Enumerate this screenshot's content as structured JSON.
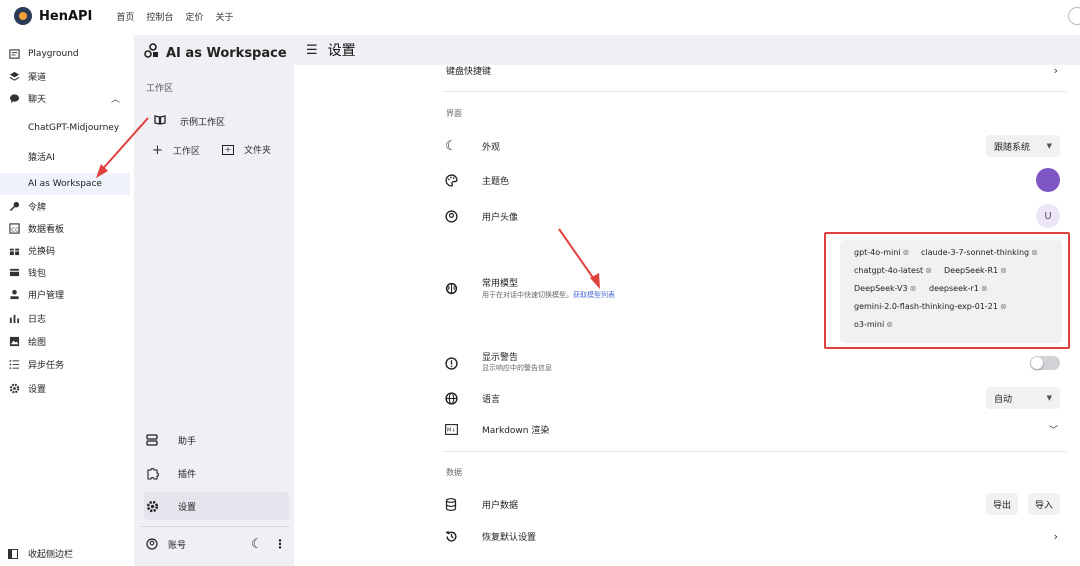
{
  "brand": {
    "name": "HenAPI"
  },
  "topnav": [
    "首页",
    "控制台",
    "定价",
    "关于"
  ],
  "sidebar": {
    "items": [
      {
        "label": "Playground",
        "icon": "chat-square-icon"
      },
      {
        "label": "渠道",
        "icon": "layers-icon"
      },
      {
        "label": "聊天",
        "icon": "chat-bubble-icon",
        "expanded": true
      }
    ],
    "chat_sub": [
      "ChatGPT-Midjourney",
      "猿活AI",
      "AI as Workspace"
    ],
    "items2": [
      {
        "label": "令牌",
        "icon": "key-icon"
      },
      {
        "label": "数据看板",
        "icon": "dashboard-icon"
      },
      {
        "label": "兑换码",
        "icon": "gift-icon"
      },
      {
        "label": "钱包",
        "icon": "wallet-icon"
      },
      {
        "label": "用户管理",
        "icon": "user-icon"
      },
      {
        "label": "日志",
        "icon": "chart-icon"
      },
      {
        "label": "绘图",
        "icon": "image-icon"
      },
      {
        "label": "异步任务",
        "icon": "list-icon"
      },
      {
        "label": "设置",
        "icon": "gear-icon"
      }
    ],
    "collapse_label": "收起侧边栏"
  },
  "workspace": {
    "title": "AI as Workspace",
    "section": "工作区",
    "example": "示例工作区",
    "add_workspace": "工作区",
    "add_folder": "文件夹",
    "bottom": {
      "assistant": "助手",
      "plugins": "插件",
      "settings": "设置",
      "account": "账号"
    }
  },
  "main": {
    "title": "设置",
    "keyboard": "键盘快捷键",
    "section_ui": "界面",
    "appearance": {
      "label": "外观",
      "value": "跟随系统"
    },
    "theme_color": {
      "label": "主题色",
      "color": "#7e57c2"
    },
    "avatar": {
      "label": "用户头像",
      "initial": "U"
    },
    "models": {
      "label": "常用模型",
      "desc": "用于在对话中快速切换模型。",
      "link": "获取模型列表",
      "chips": [
        "gpt-4o-mini",
        "claude-3-7-sonnet-thinking",
        "chatgpt-4o-latest",
        "DeepSeek-R1",
        "DeepSeek-V3",
        "deepseek-r1",
        "gemini-2.0-flash-thinking-exp-01-21",
        "o3-mini"
      ]
    },
    "warning": {
      "label": "显示警告",
      "desc": "显示响应中的警告信息"
    },
    "language": {
      "label": "语言",
      "value": "自动"
    },
    "markdown": {
      "label": "Markdown 渲染"
    },
    "section_data": "数据",
    "user_data": {
      "label": "用户数据",
      "export": "导出",
      "import": "导入"
    },
    "reset": {
      "label": "恢复默认设置"
    }
  }
}
